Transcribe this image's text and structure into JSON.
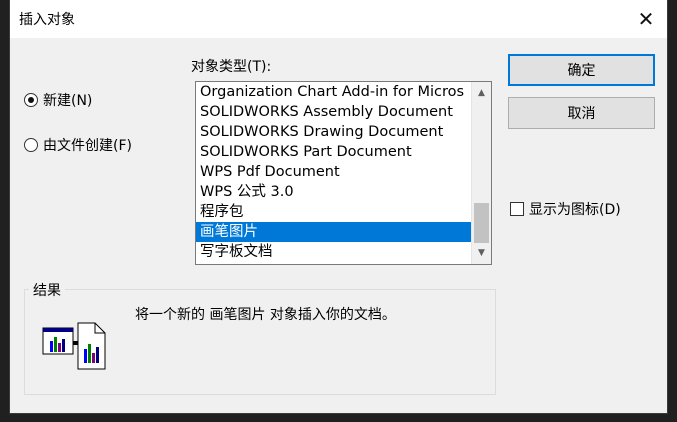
{
  "window": {
    "title": "插入对象",
    "close_glyph": "✕"
  },
  "source_options": {
    "create_new": {
      "label": "新建(N)",
      "checked": true
    },
    "create_from_file": {
      "label": "由文件创建(F)",
      "checked": false
    }
  },
  "object_type": {
    "label": "对象类型(T):",
    "items": [
      "Organization Chart Add-in for Micros",
      "SOLIDWORKS Assembly Document",
      "SOLIDWORKS Drawing Document",
      "SOLIDWORKS Part Document",
      "WPS Pdf Document",
      "WPS 公式 3.0",
      "程序包",
      "画笔图片",
      "写字板文档"
    ],
    "selected": "画笔图片"
  },
  "buttons": {
    "ok": "确定",
    "cancel": "取消"
  },
  "display_as_icon": {
    "label": "显示为图标(D)",
    "checked": false
  },
  "result": {
    "label": "结果",
    "text": "将一个新的 画笔图片 对象插入你的文档。",
    "icon": "insert-object-icon"
  },
  "colors": {
    "selection": "#0078d7",
    "default_button_border": "#0078d7"
  }
}
